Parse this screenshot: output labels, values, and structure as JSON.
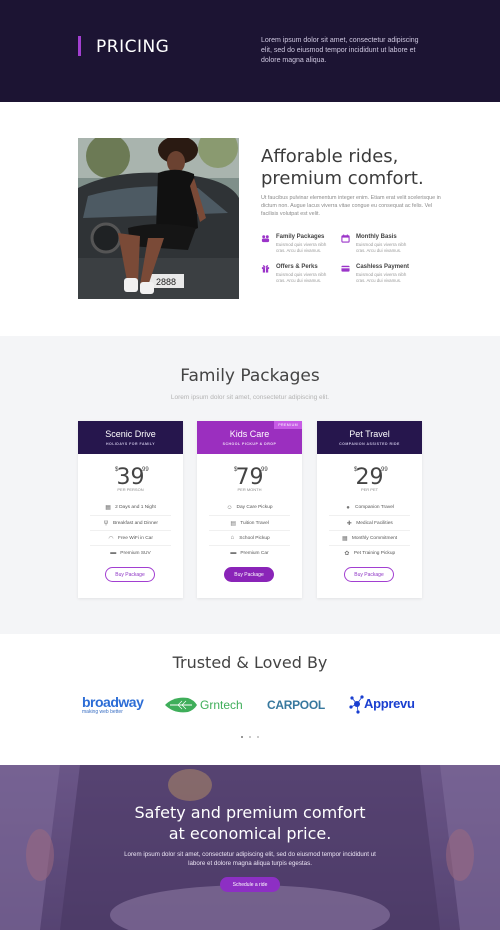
{
  "hero": {
    "title": "PRICING",
    "description": "Lorem ipsum dolor sit amet, consectetur adipiscing elit, sed do eiusmod tempor incididunt ut labore et dolore magna aliqua."
  },
  "about": {
    "heading_line1": "Afforable rides,",
    "heading_line2": "premium comfort.",
    "paragraph": "Ut faucibus pulvinar elementum integer enim. Etiam erat velit scelerisque in dictum non. Augue lacus viverra vitae congue eu consequat ac felis. Vel facilisis volutpat est velit.",
    "features": [
      {
        "icon": "family-icon",
        "title": "Family Packages",
        "desc": "Euismod quis viverra nibh cras. Arcu dui vivamus."
      },
      {
        "icon": "calendar-icon",
        "title": "Monthly Basis",
        "desc": "Euismod quis viverra nibh cras. Arcu dui vivamus."
      },
      {
        "icon": "gift-icon",
        "title": "Offers & Perks",
        "desc": "Euismod quis viverra nibh cras. Arcu dui vivamus."
      },
      {
        "icon": "credit-card-icon",
        "title": "Cashless Payment",
        "desc": "Euismod quis viverra nibh cras. Arcu dui vivamus."
      }
    ]
  },
  "packages": {
    "heading": "Family Packages",
    "subheading": "Lorem ipsum dolor sit amet, consectetur adipiscing elit.",
    "cards": [
      {
        "name": "Scenic Drive",
        "tag": "HOLIDAYS FOR FAMILY",
        "currency": "$",
        "price": "39",
        "cents": "99",
        "period": "PER PERSON",
        "items": [
          "2 Days and 1 Night",
          "Breakfast and Dinner",
          "Free WiFi in Car",
          "Premium SUV"
        ],
        "icons": [
          "calendar-icon",
          "utensils-icon",
          "wifi-icon",
          "car-icon"
        ],
        "button": "Buy Package"
      },
      {
        "name": "Kids Care",
        "tag": "SCHOOL PICKUP & DROP",
        "ribbon": "PREMIUM",
        "currency": "$",
        "price": "79",
        "cents": "99",
        "period": "PER MONTH",
        "items": [
          "Day Care Pickup",
          "Tuition Travel",
          "School Pickup",
          "Premium Car"
        ],
        "icons": [
          "child-icon",
          "book-icon",
          "school-icon",
          "car-icon"
        ],
        "button": "Buy Package"
      },
      {
        "name": "Pet Travel",
        "tag": "COMPANION ASSISTED RIDE",
        "currency": "$",
        "price": "29",
        "cents": "99",
        "period": "PER PET",
        "items": [
          "Companion Travel",
          "Medical Facilities",
          "Monthly Commitment",
          "Pet Training Pickup"
        ],
        "icons": [
          "user-icon",
          "ambulance-icon",
          "calendar-icon",
          "paw-icon"
        ],
        "button": "Buy Package"
      }
    ]
  },
  "trusted": {
    "heading": "Trusted & Loved By",
    "logos": {
      "broadway": "broadway",
      "broadway_tag": "making web better",
      "grntech": "Grntech",
      "carpool": "CARPOOL",
      "apprevu": "Apprevu"
    }
  },
  "cta": {
    "heading_line1": "Safety and premium comfort",
    "heading_line2": "at economical price.",
    "paragraph": "Lorem ipsum dolor sit amet, consectetur adipiscing elit, sed do eiusmod tempor incididunt ut labore et dolore magna aliqua turpis egestas.",
    "button": "Schedule a ride"
  },
  "colors": {
    "accent": "#a23fd1",
    "dark": "#1c1433",
    "card_head": "#26164d"
  }
}
